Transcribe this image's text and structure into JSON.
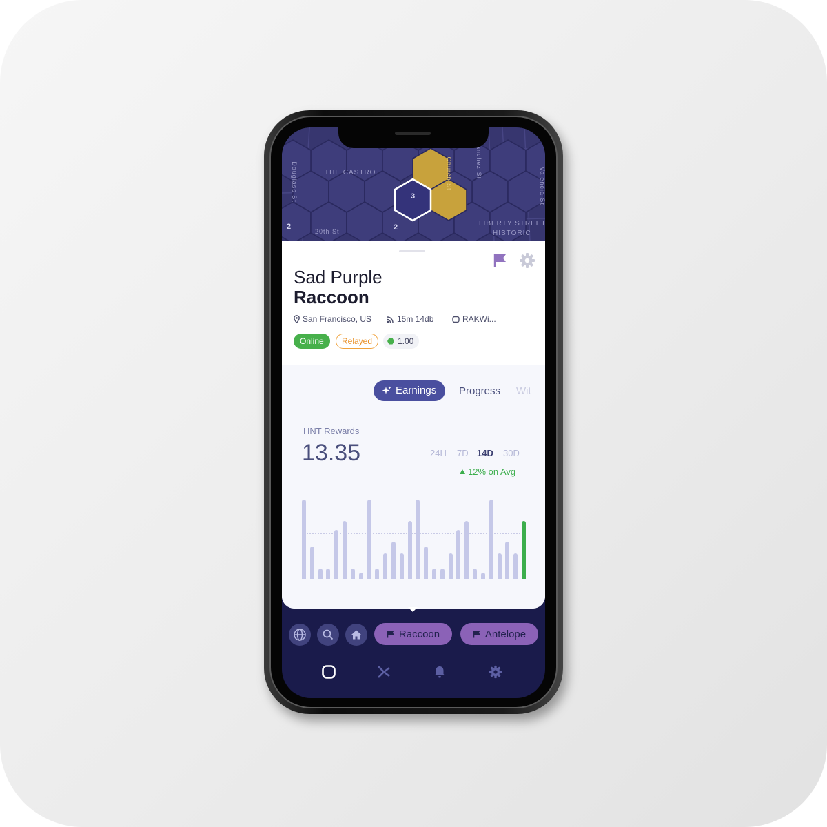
{
  "map": {
    "labels": [
      "THE CASTRO",
      "Douglass St",
      "Valencia St",
      "LIBERTY STREET",
      "HISTORIC",
      "20th St",
      "Church St",
      "Sanchez St"
    ],
    "hex_counts": [
      "3",
      "2",
      "2"
    ],
    "colors": {
      "background": "#37366f",
      "hex_fill": "#3e3d7b",
      "hex_highlight": "#c8a23c",
      "hex_selected": "#ffffff"
    }
  },
  "hotspot": {
    "name_first": "Sad Purple",
    "name_last": "Raccoon",
    "location": "San Francisco, US",
    "signal": "15m 14db",
    "maker": "RAKWi...",
    "status": "Online",
    "relay": "Relayed",
    "scale": "1.00",
    "icons": {
      "flag": "flag-icon",
      "settings": "gear-icon",
      "location": "location-pin-icon",
      "signal": "signal-icon",
      "maker": "device-icon"
    }
  },
  "tabs": {
    "items": [
      "Earnings",
      "Progress",
      "Wit"
    ],
    "active": "Earnings"
  },
  "rewards": {
    "label": "HNT Rewards",
    "value": "13.35",
    "ranges": [
      "24H",
      "7D",
      "14D",
      "30D"
    ],
    "active_range": "14D",
    "trend": "12% on Avg",
    "trend_color": "#3cae4c"
  },
  "chart_data": {
    "type": "bar",
    "title": "",
    "xlabel": "",
    "ylabel": "",
    "values": [
      1.0,
      0.41,
      0.13,
      0.13,
      0.62,
      0.73,
      0.13,
      0.08,
      1.0,
      0.13,
      0.32,
      0.47,
      0.32,
      0.73,
      1.0,
      0.41,
      0.13,
      0.13,
      0.32,
      0.62,
      0.73,
      0.13,
      0.08,
      1.0,
      0.32,
      0.47,
      0.32,
      0.73
    ],
    "average": 0.58,
    "highlight_last": true,
    "colors": {
      "bar": "#c5c8e8",
      "last_bar": "#3cae4c"
    }
  },
  "quick_nav": {
    "buttons": [
      "globe-icon",
      "search-icon",
      "home-icon"
    ],
    "hotspots": [
      "Raccoon",
      "Antelope"
    ]
  },
  "tab_bar": {
    "items": [
      "hotspots-icon",
      "transactions-icon",
      "notifications-icon",
      "settings-icon"
    ]
  }
}
